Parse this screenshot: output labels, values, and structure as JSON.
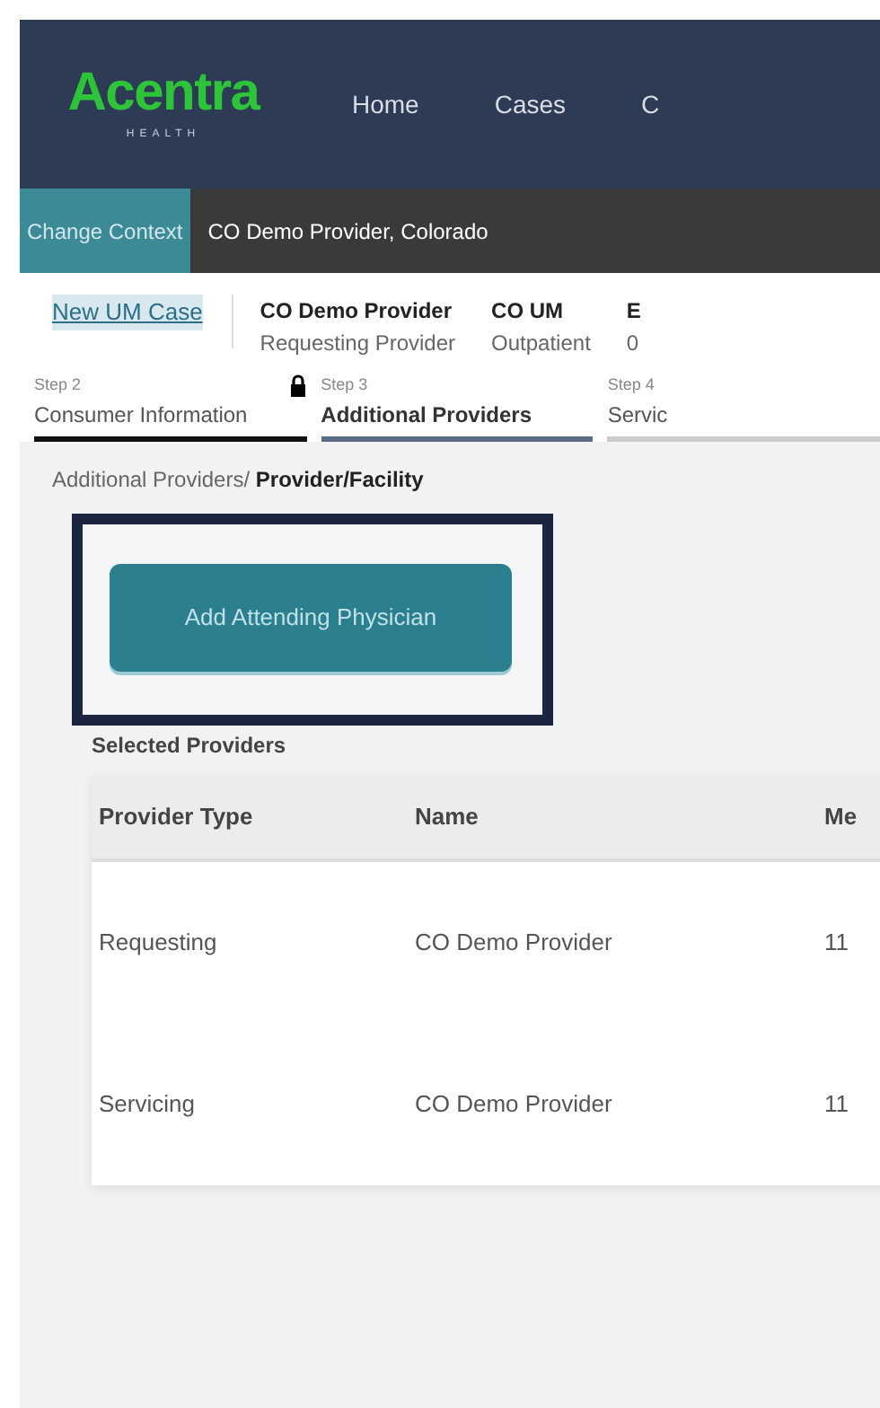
{
  "header": {
    "logo": "Acentra",
    "logo_sub": "HEALTH",
    "nav": [
      {
        "label": "Home"
      },
      {
        "label": "Cases"
      },
      {
        "label": "C"
      }
    ]
  },
  "context_bar": {
    "button": "Change Context",
    "text": "CO Demo Provider, Colorado"
  },
  "case_bar": {
    "link": "New UM Case",
    "fields": [
      {
        "value": "CO Demo Provider",
        "label": "Requesting Provider"
      },
      {
        "value": "CO UM",
        "label": "Outpatient"
      },
      {
        "value": "E",
        "label": "0"
      }
    ]
  },
  "steps": [
    {
      "step": "Step 2",
      "label": "Consumer Information",
      "locked": true,
      "complete": true,
      "selected": false
    },
    {
      "step": "Step 3",
      "label": "Additional Providers",
      "locked": false,
      "complete": false,
      "selected": true
    },
    {
      "step": "Step 4",
      "label": "Servic",
      "locked": false,
      "complete": false,
      "selected": false
    }
  ],
  "breadcrumb": {
    "parent": "Additional Providers/",
    "current": "Provider/Facility"
  },
  "add_button": "Add Attending Physician",
  "table": {
    "title": "Selected Providers",
    "columns": [
      "Provider Type",
      "Name",
      "Me"
    ],
    "rows": [
      [
        "Requesting",
        "CO Demo Provider",
        "11"
      ],
      [
        "Servicing",
        "CO Demo Provider",
        "11"
      ]
    ]
  }
}
